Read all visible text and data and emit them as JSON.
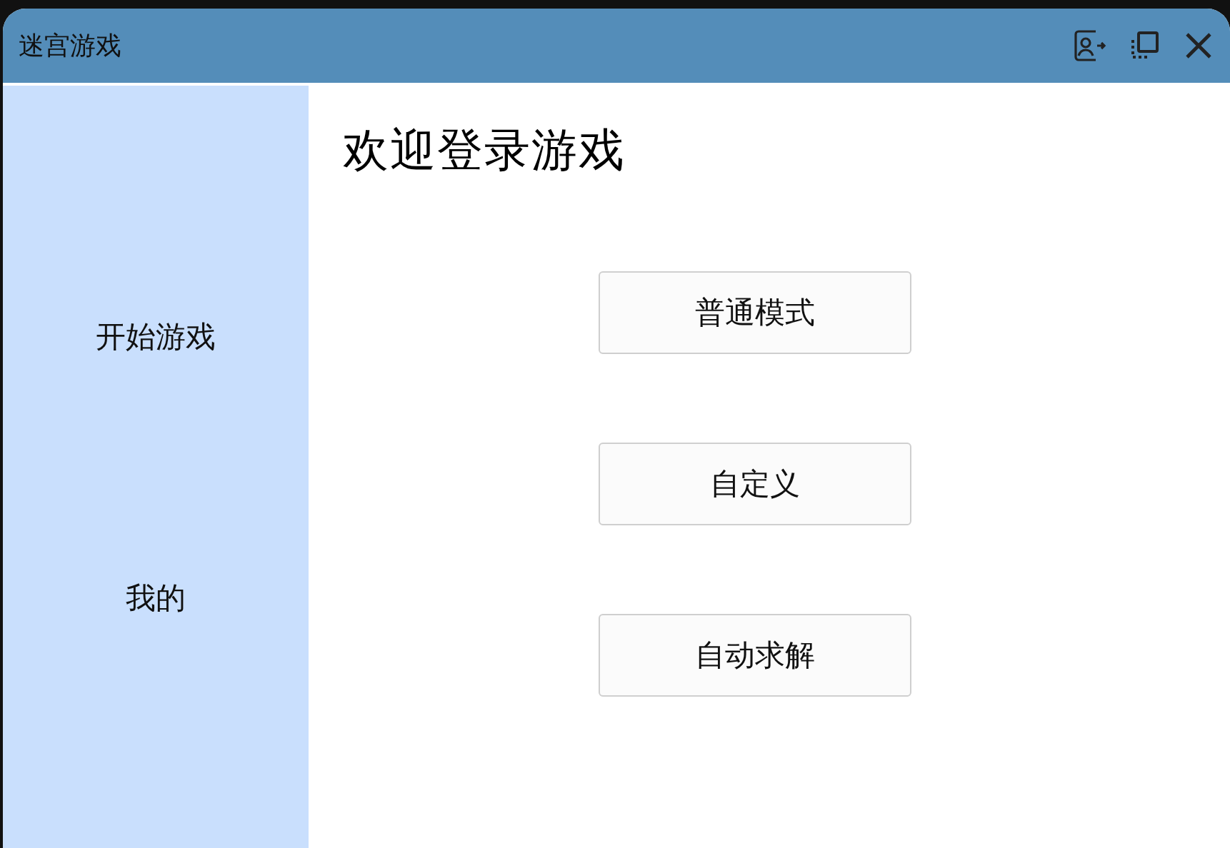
{
  "window": {
    "title": "迷宫游戏"
  },
  "sidebar": {
    "items": [
      {
        "label": "开始游戏"
      },
      {
        "label": "我的"
      }
    ]
  },
  "content": {
    "heading": "欢迎登录游戏",
    "buttons": [
      {
        "label": "普通模式"
      },
      {
        "label": "自定义"
      },
      {
        "label": "自动求解"
      }
    ]
  }
}
